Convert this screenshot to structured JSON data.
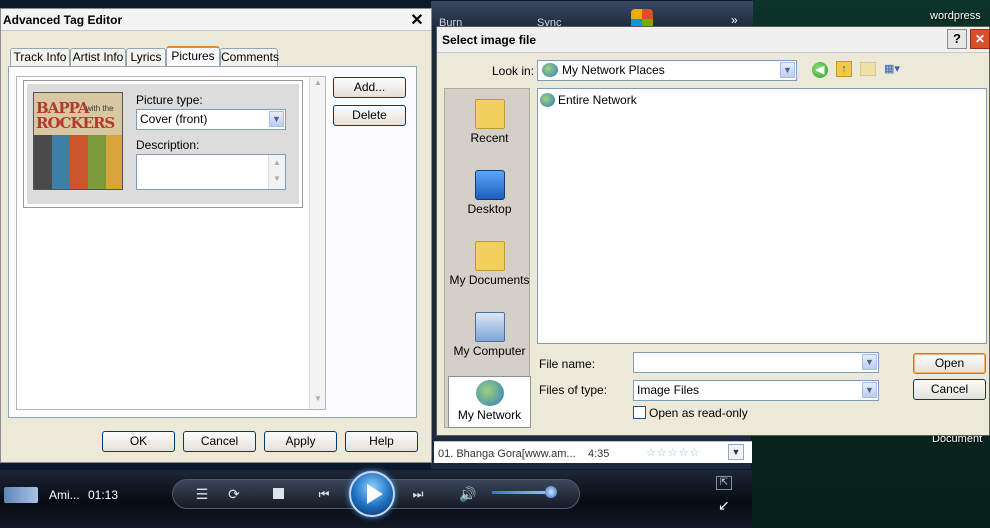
{
  "desktop": {
    "labels": [
      "wordpress",
      "Document"
    ]
  },
  "wmp_back": {
    "top_text_1": "Burn",
    "top_text_2": "Sync",
    "list_row": {
      "title": "01. Bhanga Gora[www.am...",
      "duration": "4:35"
    }
  },
  "player": {
    "track_short": "Ami...",
    "time": "01:13"
  },
  "tag_editor": {
    "title": "Advanced Tag Editor",
    "tabs": [
      {
        "label": "Track Info"
      },
      {
        "label": "Artist Info"
      },
      {
        "label": "Lyrics"
      },
      {
        "label": "Pictures",
        "active": true
      },
      {
        "label": "Comments"
      }
    ],
    "picture_type_label": "Picture type:",
    "picture_type_value": "Cover (front)",
    "description_label": "Description:",
    "description_value": "",
    "add_label": "Add...",
    "delete_label": "Delete",
    "cover_art_text": {
      "line1": "BAPPA",
      "with": "with the",
      "line2": "ROCKERS"
    },
    "footer_buttons": {
      "ok": "OK",
      "cancel": "Cancel",
      "apply": "Apply",
      "help": "Help"
    }
  },
  "file_dialog": {
    "title": "Select image file",
    "look_in_label": "Look in:",
    "look_in_value": "My Network Places",
    "places": [
      {
        "label": "Recent"
      },
      {
        "label": "Desktop"
      },
      {
        "label": "My Documents"
      },
      {
        "label": "My Computer"
      },
      {
        "label": "My Network",
        "selected": true
      }
    ],
    "files": [
      {
        "name": "Entire Network"
      }
    ],
    "file_name_label": "File name:",
    "file_name_value": "",
    "files_of_type_label": "Files of type:",
    "files_of_type_value": "Image Files",
    "read_only_label": "Open as read-only",
    "open_label": "Open",
    "cancel_label": "Cancel"
  }
}
